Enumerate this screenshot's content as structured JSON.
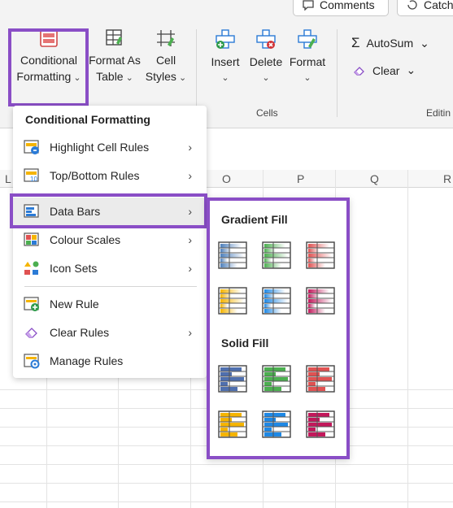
{
  "top": {
    "comments": "Comments",
    "catchup": "Catch"
  },
  "ribbon": {
    "conditional_formatting": [
      "Conditional",
      "Formatting"
    ],
    "format_as_table": [
      "Format As",
      "Table"
    ],
    "cell_styles": [
      "Cell",
      "Styles"
    ],
    "insert": "Insert",
    "delete": "Delete",
    "format": "Format",
    "cells_group": "Cells",
    "autosum": "AutoSum",
    "clear": "Clear",
    "editing_group": "Editin"
  },
  "columns": [
    "L",
    "O",
    "P",
    "Q",
    "R"
  ],
  "menu": {
    "title": "Conditional Formatting",
    "items": [
      {
        "label": "Highlight Cell Rules",
        "arrow": true
      },
      {
        "label": "Top/Bottom Rules",
        "arrow": true
      },
      {
        "label": "Data Bars",
        "arrow": true
      },
      {
        "label": "Colour Scales",
        "arrow": true
      },
      {
        "label": "Icon Sets",
        "arrow": true
      },
      {
        "label": "New Rule",
        "arrow": false
      },
      {
        "label": "Clear Rules",
        "arrow": true
      },
      {
        "label": "Manage Rules",
        "arrow": false
      }
    ]
  },
  "submenu": {
    "gradient_title": "Gradient Fill",
    "solid_title": "Solid Fill",
    "gradient_colors": [
      "#4f81bd",
      "#4caf50",
      "#e05252",
      "#f5b400",
      "#1e88e5",
      "#c2185b"
    ],
    "solid_colors": [
      "#4f6fae",
      "#4caf50",
      "#e05252",
      "#f5b400",
      "#1e88e5",
      "#c2185b"
    ]
  },
  "colors": {
    "accent": "#8a4ec6"
  }
}
